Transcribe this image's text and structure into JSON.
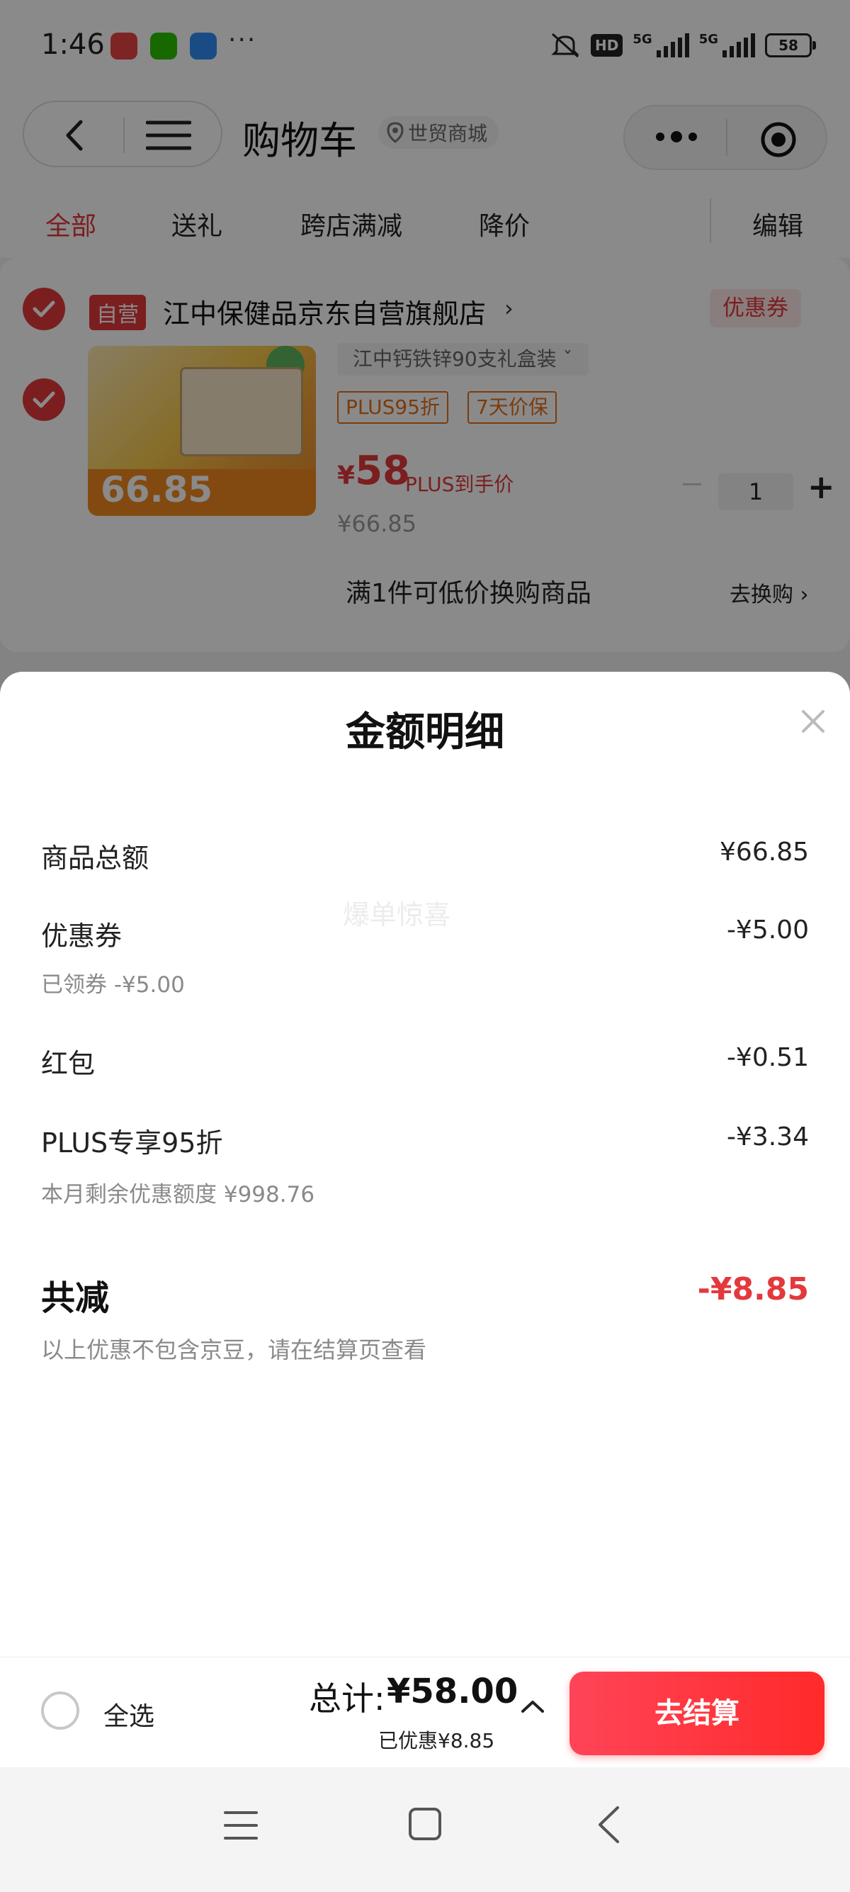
{
  "status_bar": {
    "time": "1:46",
    "more": "···",
    "hd": "HD",
    "net1": "5G",
    "net2": "5G",
    "battery": "58"
  },
  "header": {
    "title": "购物车",
    "location": "世贸商城"
  },
  "tabs": [
    "全部",
    "送礼",
    "跨店满减",
    "降价"
  ],
  "edit_label": "编辑",
  "shop": {
    "self_operated_badge": "自营",
    "name": "江中保健品京东自营旗舰店",
    "coupon_tag": "优惠券"
  },
  "product": {
    "image_price": "66.85",
    "spec": "江中钙铁锌90支礼盒装",
    "tags": [
      "PLUS95折",
      "7天价保"
    ],
    "price_yen": "¥",
    "price_num": "58",
    "plus_price_label": "PLUS到手价",
    "original_price": "¥66.85",
    "quantity": "1",
    "exchange_text": "满1件可低价换购商品",
    "go_exchange": "去换购"
  },
  "sheet": {
    "title": "金额明细",
    "watermark": "爆单惊喜",
    "rows": [
      {
        "label": "商品总额",
        "value": "¥66.85",
        "sub": ""
      },
      {
        "label": "优惠券",
        "value": "-¥5.00",
        "sub": "已领券 -¥5.00"
      },
      {
        "label": "红包",
        "value": "-¥0.51",
        "sub": ""
      },
      {
        "label": "PLUS专享95折",
        "value": "-¥3.34",
        "sub": "本月剩余优惠额度 ¥998.76"
      }
    ],
    "total_label": "共减",
    "total_value": "-¥8.85",
    "total_note": "以上优惠不包含京豆，请在结算页查看"
  },
  "bottom_bar": {
    "select_all": "全选",
    "sum_label": "总计:",
    "sum_value": "¥58.00",
    "discount": "已优惠¥8.85",
    "checkout": "去结算"
  },
  "colors": {
    "accent": "#e4393c",
    "tag_orange": "#e2701a"
  }
}
